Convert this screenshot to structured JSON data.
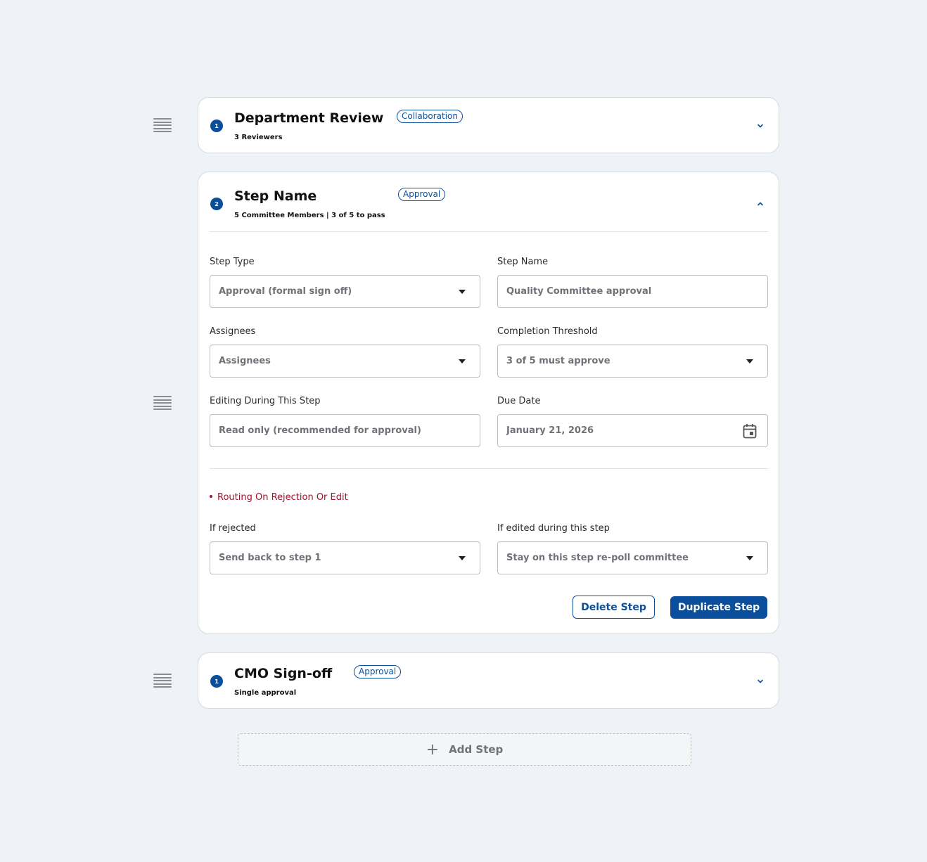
{
  "steps": [
    {
      "number": "1",
      "title": "Department Review",
      "subtitle": "3 Reviewers",
      "badge": "Collaboration",
      "expanded": false
    },
    {
      "number": "2",
      "title": "Step Name",
      "subtitle": "5 Committee Members | 3 of 5 to pass",
      "badge": "Approval",
      "expanded": true,
      "form": {
        "step_type": {
          "label": "Step Type",
          "value": "Approval (formal sign off)"
        },
        "step_name": {
          "label": "Step Name",
          "value": "Quality Committee approval"
        },
        "assignees": {
          "label": "Assignees",
          "value": "Assignees"
        },
        "completion_threshold": {
          "label": "Completion Threshold",
          "value": "3 of 5 must approve"
        },
        "editing": {
          "label": "Editing During This Step",
          "value": "Read only (recommended for approval)"
        },
        "due_date": {
          "label": "Due Date",
          "value": "January 21, 2026"
        },
        "routing_title": "Routing On Rejection Or Edit",
        "if_rejected": {
          "label": "If rejected",
          "value": "Send back to step 1"
        },
        "if_edited": {
          "label": "If edited during this step",
          "value": "Stay on this step re-poll committee"
        }
      },
      "actions": {
        "delete": "Delete Step",
        "duplicate": "Duplicate Step"
      }
    },
    {
      "number": "1",
      "title": "CMO Sign-off",
      "subtitle": "Single approval",
      "badge": "Approval",
      "expanded": false
    }
  ],
  "add_step_label": "Add Step",
  "icons": {
    "drag": "drag-handle-icon",
    "collapse": "chevron-down-icon",
    "expand": "chevron-up-icon",
    "dropdown": "caret-down-icon",
    "calendar": "calendar-icon",
    "add": "plus-icon"
  },
  "colors": {
    "accent": "#0b4f9c",
    "danger": "#a3122e",
    "background": "#eff2f7"
  }
}
